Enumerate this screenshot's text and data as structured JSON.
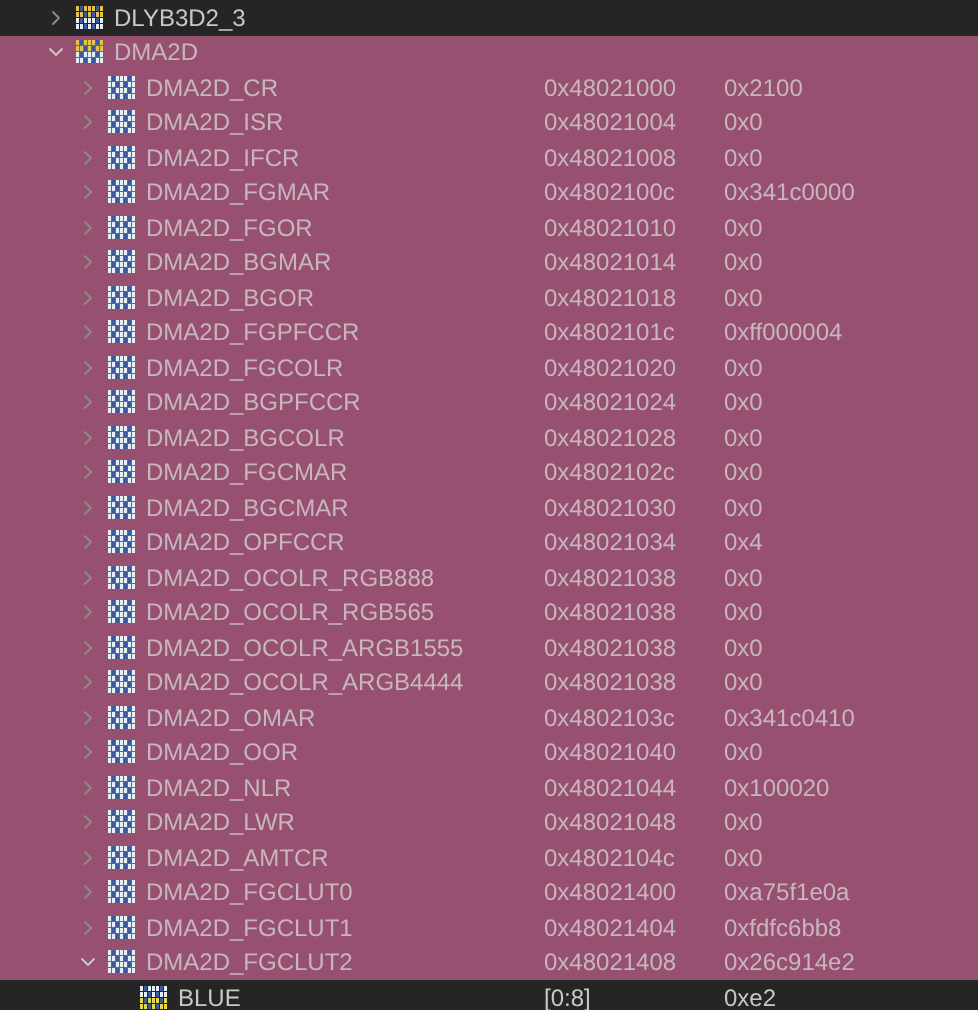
{
  "peripherals": [
    {
      "name": "DLYB3D2_3",
      "kind": "peripheral",
      "expanded": false,
      "selected": false
    },
    {
      "name": "DMA2D",
      "kind": "peripheral",
      "expanded": true,
      "selected": true,
      "children": [
        {
          "name": "DMA2D_CR",
          "kind": "register",
          "address": "0x48021000",
          "value": "0x2100",
          "expanded": false,
          "selected": true
        },
        {
          "name": "DMA2D_ISR",
          "kind": "register",
          "address": "0x48021004",
          "value": "0x0",
          "expanded": false,
          "selected": true
        },
        {
          "name": "DMA2D_IFCR",
          "kind": "register",
          "address": "0x48021008",
          "value": "0x0",
          "expanded": false,
          "selected": true
        },
        {
          "name": "DMA2D_FGMAR",
          "kind": "register",
          "address": "0x4802100c",
          "value": "0x341c0000",
          "expanded": false,
          "selected": true
        },
        {
          "name": "DMA2D_FGOR",
          "kind": "register",
          "address": "0x48021010",
          "value": "0x0",
          "expanded": false,
          "selected": true
        },
        {
          "name": "DMA2D_BGMAR",
          "kind": "register",
          "address": "0x48021014",
          "value": "0x0",
          "expanded": false,
          "selected": true
        },
        {
          "name": "DMA2D_BGOR",
          "kind": "register",
          "address": "0x48021018",
          "value": "0x0",
          "expanded": false,
          "selected": true
        },
        {
          "name": "DMA2D_FGPFCCR",
          "kind": "register",
          "address": "0x4802101c",
          "value": "0xff000004",
          "expanded": false,
          "selected": true
        },
        {
          "name": "DMA2D_FGCOLR",
          "kind": "register",
          "address": "0x48021020",
          "value": "0x0",
          "expanded": false,
          "selected": true
        },
        {
          "name": "DMA2D_BGPFCCR",
          "kind": "register",
          "address": "0x48021024",
          "value": "0x0",
          "expanded": false,
          "selected": true
        },
        {
          "name": "DMA2D_BGCOLR",
          "kind": "register",
          "address": "0x48021028",
          "value": "0x0",
          "expanded": false,
          "selected": true
        },
        {
          "name": "DMA2D_FGCMAR",
          "kind": "register",
          "address": "0x4802102c",
          "value": "0x0",
          "expanded": false,
          "selected": true
        },
        {
          "name": "DMA2D_BGCMAR",
          "kind": "register",
          "address": "0x48021030",
          "value": "0x0",
          "expanded": false,
          "selected": true
        },
        {
          "name": "DMA2D_OPFCCR",
          "kind": "register",
          "address": "0x48021034",
          "value": "0x4",
          "expanded": false,
          "selected": true
        },
        {
          "name": "DMA2D_OCOLR_RGB888",
          "kind": "register",
          "address": "0x48021038",
          "value": "0x0",
          "expanded": false,
          "selected": true
        },
        {
          "name": "DMA2D_OCOLR_RGB565",
          "kind": "register",
          "address": "0x48021038",
          "value": "0x0",
          "expanded": false,
          "selected": true
        },
        {
          "name": "DMA2D_OCOLR_ARGB1555",
          "kind": "register",
          "address": "0x48021038",
          "value": "0x0",
          "expanded": false,
          "selected": true
        },
        {
          "name": "DMA2D_OCOLR_ARGB4444",
          "kind": "register",
          "address": "0x48021038",
          "value": "0x0",
          "expanded": false,
          "selected": true
        },
        {
          "name": "DMA2D_OMAR",
          "kind": "register",
          "address": "0x4802103c",
          "value": "0x341c0410",
          "expanded": false,
          "selected": true
        },
        {
          "name": "DMA2D_OOR",
          "kind": "register",
          "address": "0x48021040",
          "value": "0x0",
          "expanded": false,
          "selected": true
        },
        {
          "name": "DMA2D_NLR",
          "kind": "register",
          "address": "0x48021044",
          "value": "0x100020",
          "expanded": false,
          "selected": true
        },
        {
          "name": "DMA2D_LWR",
          "kind": "register",
          "address": "0x48021048",
          "value": "0x0",
          "expanded": false,
          "selected": true
        },
        {
          "name": "DMA2D_AMTCR",
          "kind": "register",
          "address": "0x4802104c",
          "value": "0x0",
          "expanded": false,
          "selected": true
        },
        {
          "name": "DMA2D_FGCLUT0",
          "kind": "register",
          "address": "0x48021400",
          "value": "0xa75f1e0a",
          "expanded": false,
          "selected": true
        },
        {
          "name": "DMA2D_FGCLUT1",
          "kind": "register",
          "address": "0x48021404",
          "value": "0xfdfc6bb8",
          "expanded": false,
          "selected": true
        },
        {
          "name": "DMA2D_FGCLUT2",
          "kind": "register",
          "address": "0x48021408",
          "value": "0x26c914e2",
          "expanded": true,
          "selected": true,
          "children": [
            {
              "name": "BLUE",
              "kind": "field",
              "address": "[0:8]",
              "value": "0xe2",
              "selected": false
            }
          ]
        }
      ]
    }
  ]
}
